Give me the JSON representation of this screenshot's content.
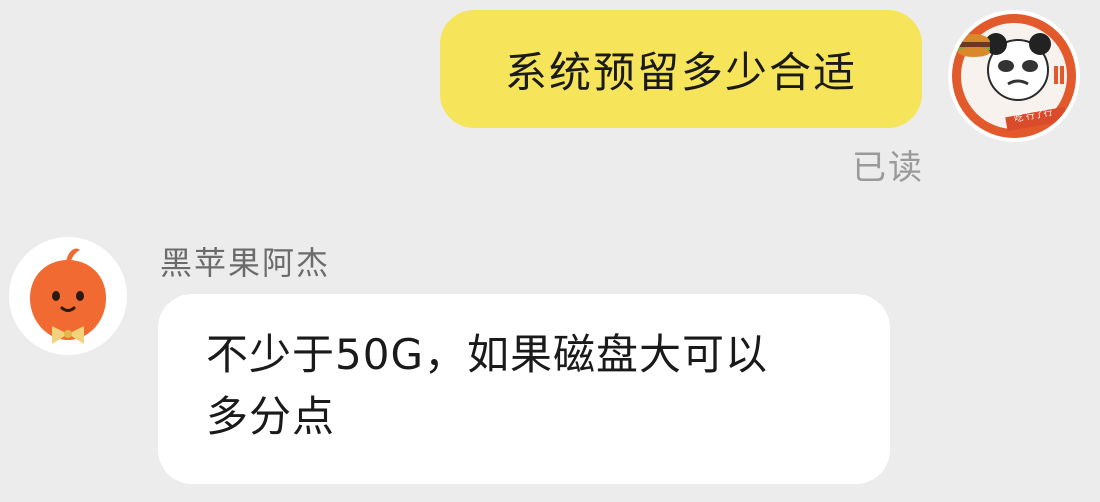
{
  "messages": {
    "outgoing": {
      "text": "系统预留多少合适",
      "status": "已读"
    },
    "incoming": {
      "sender": "黑苹果阿杰",
      "lines": [
        "不少于50G，如果磁盘大可以",
        "多分点"
      ]
    }
  },
  "avatars": {
    "self": {
      "icon": "panda-meme-avatar-icon",
      "badge_text": "吃 行了行"
    },
    "other": {
      "icon": "orange-mascot-avatar-icon"
    }
  },
  "colors": {
    "background": "#ececec",
    "outgoing_bubble": "#f6e45a",
    "incoming_bubble": "#ffffff",
    "mascot_orange": "#f06a32"
  }
}
